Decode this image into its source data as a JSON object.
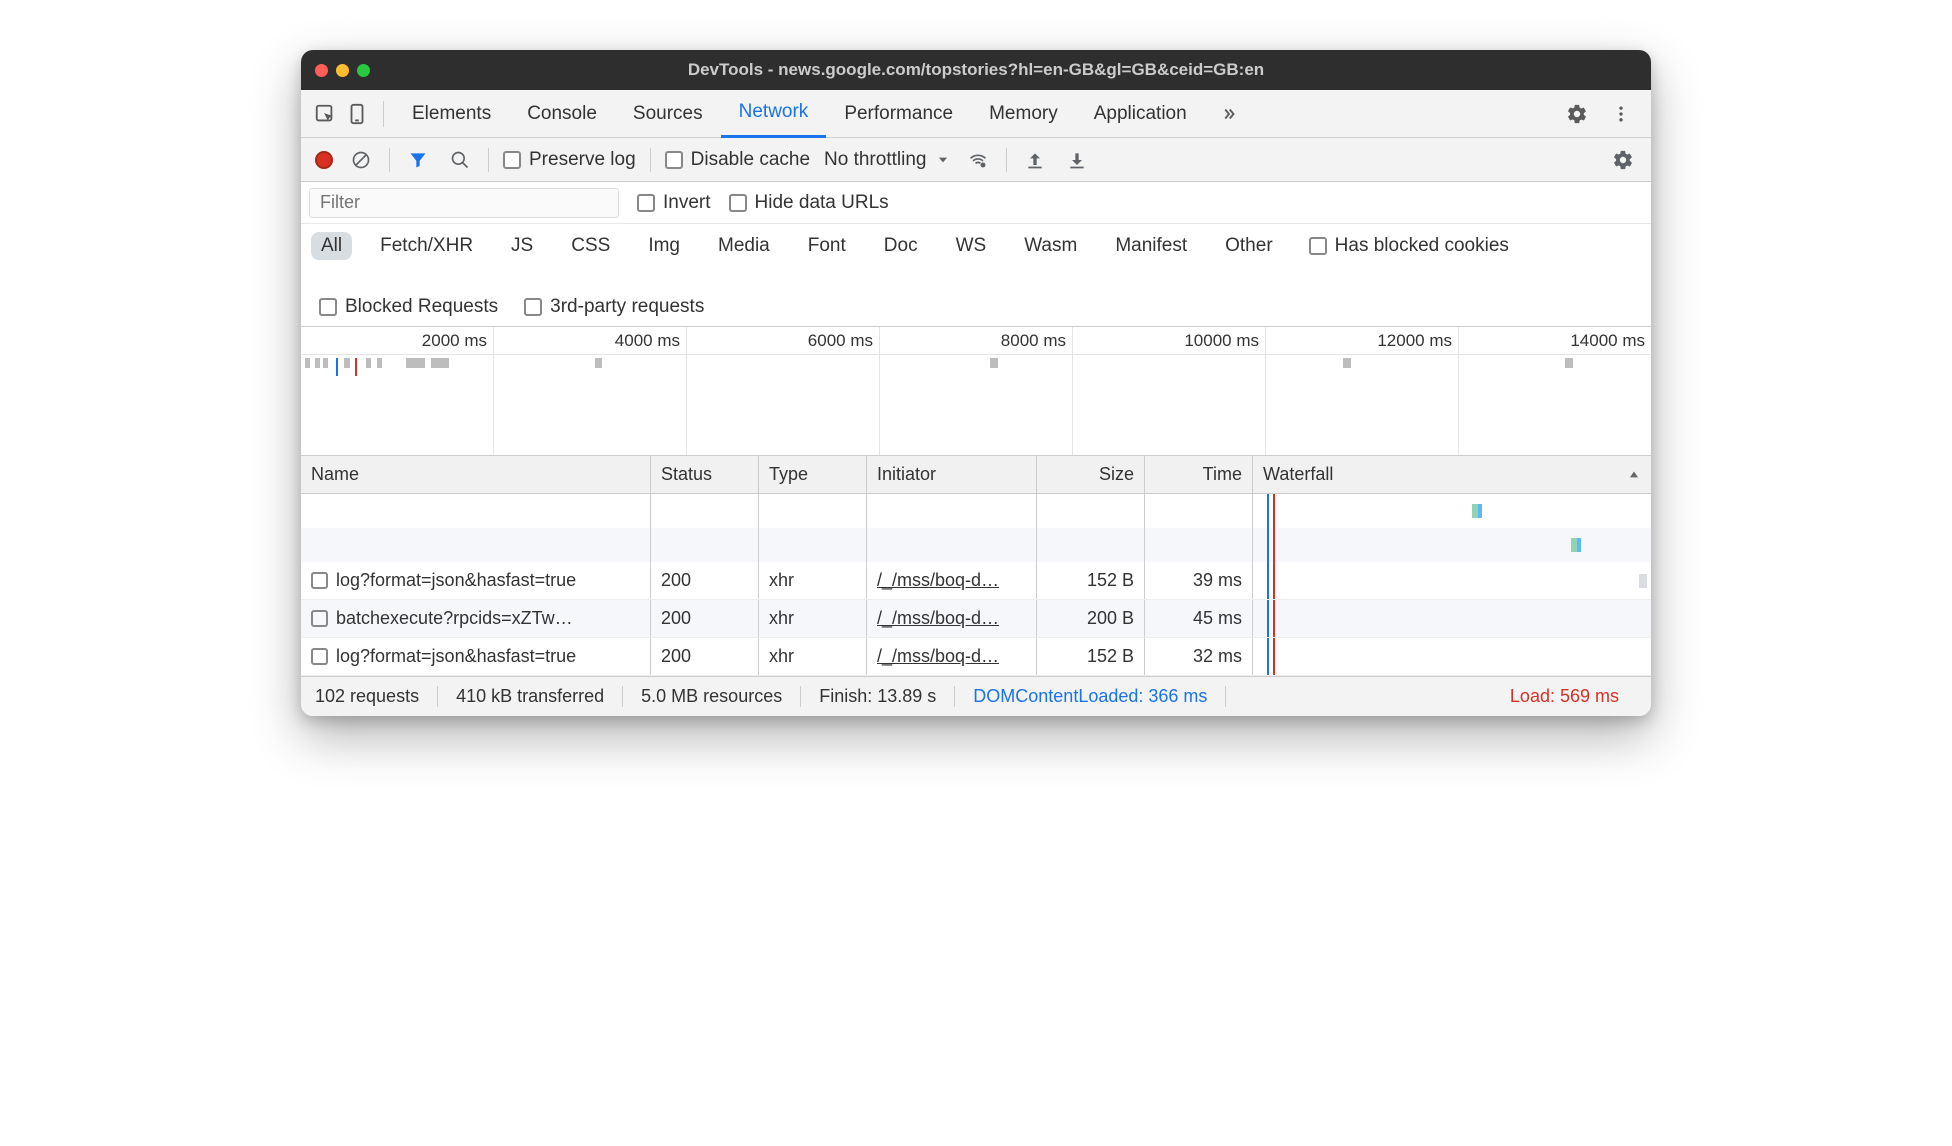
{
  "titlebar": {
    "title": "DevTools - news.google.com/topstories?hl=en-GB&gl=GB&ceid=GB:en"
  },
  "tabs": {
    "items": [
      "Elements",
      "Console",
      "Sources",
      "Network",
      "Performance",
      "Memory",
      "Application"
    ],
    "active": "Network"
  },
  "toolbar": {
    "preserve_log": "Preserve log",
    "disable_cache": "Disable cache",
    "throttling": "No throttling"
  },
  "filter": {
    "placeholder": "Filter",
    "invert": "Invert",
    "hide_data_urls": "Hide data URLs"
  },
  "types": {
    "items": [
      "All",
      "Fetch/XHR",
      "JS",
      "CSS",
      "Img",
      "Media",
      "Font",
      "Doc",
      "WS",
      "Wasm",
      "Manifest",
      "Other"
    ],
    "active": "All",
    "has_blocked_cookies": "Has blocked cookies",
    "blocked_requests": "Blocked Requests",
    "third_party": "3rd-party requests"
  },
  "timeline": {
    "ticks": [
      "2000 ms",
      "4000 ms",
      "6000 ms",
      "8000 ms",
      "10000 ms",
      "12000 ms",
      "14000 ms"
    ]
  },
  "table": {
    "headers": {
      "name": "Name",
      "status": "Status",
      "type": "Type",
      "initiator": "Initiator",
      "size": "Size",
      "time": "Time",
      "waterfall": "Waterfall"
    },
    "rows": [
      {
        "name": "log?format=json&hasfast=true",
        "status": "200",
        "type": "xhr",
        "initiator": "/_/mss/boq-d…",
        "size": "152 B",
        "time": "39 ms"
      },
      {
        "name": "batchexecute?rpcids=xZTw…",
        "status": "200",
        "type": "xhr",
        "initiator": "/_/mss/boq-d…",
        "size": "200 B",
        "time": "45 ms"
      },
      {
        "name": "log?format=json&hasfast=true",
        "status": "200",
        "type": "xhr",
        "initiator": "/_/mss/boq-d…",
        "size": "152 B",
        "time": "32 ms"
      }
    ]
  },
  "statusbar": {
    "requests": "102 requests",
    "transferred": "410 kB transferred",
    "resources": "5.0 MB resources",
    "finish": "Finish: 13.89 s",
    "dcl": "DOMContentLoaded: 366 ms",
    "load": "Load: 569 ms"
  }
}
